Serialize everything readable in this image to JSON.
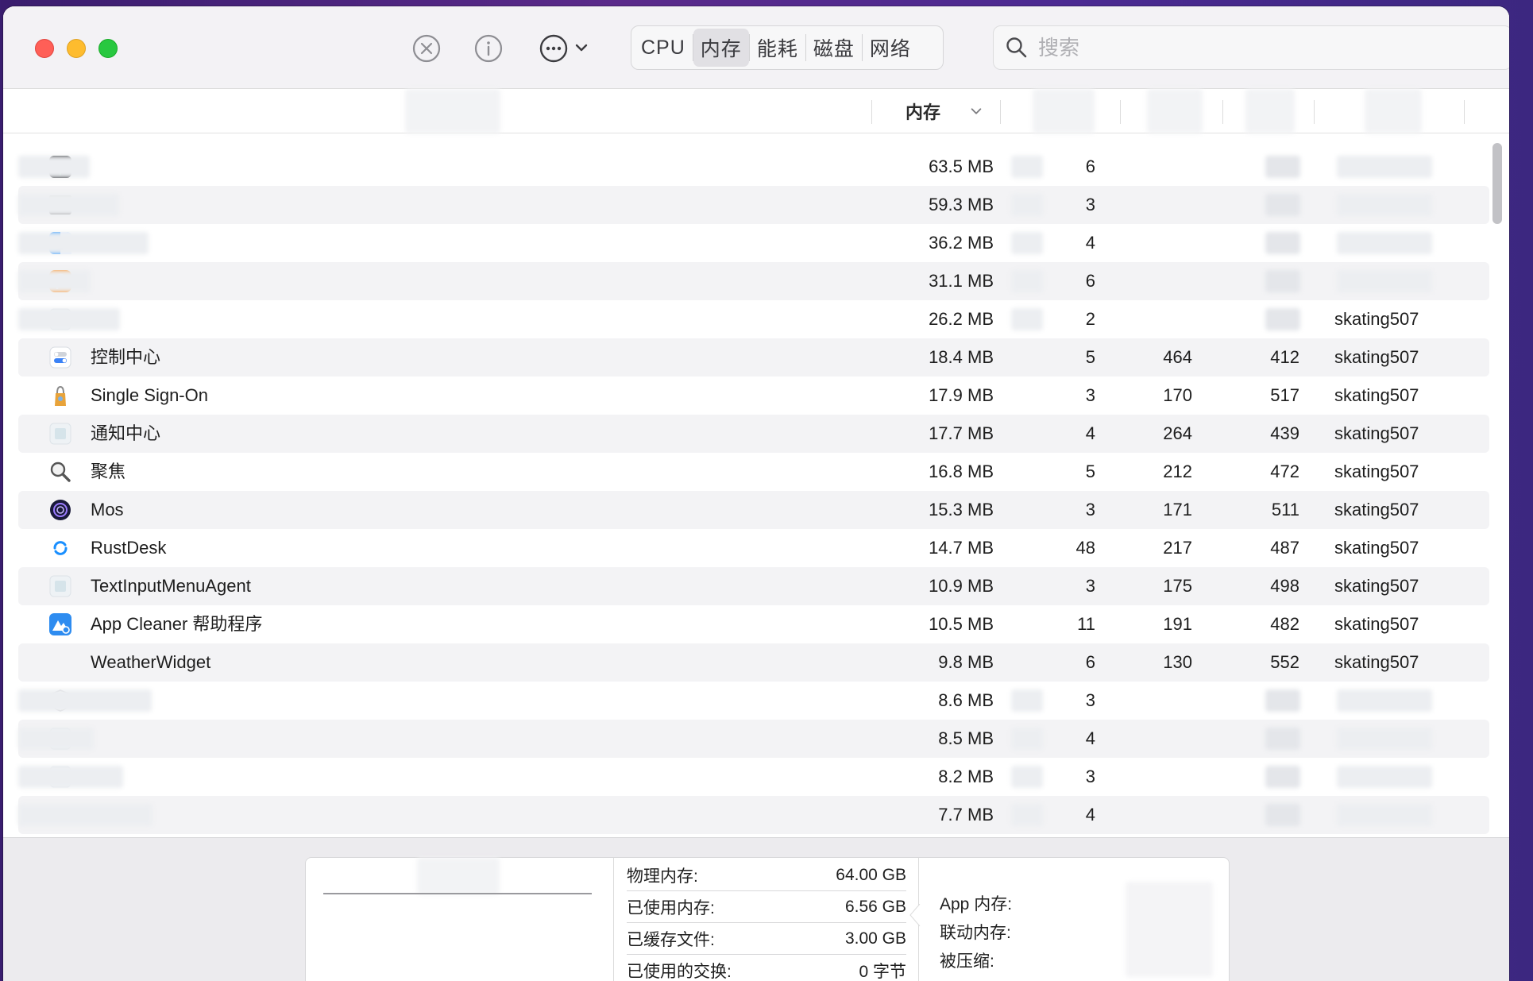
{
  "toolbar": {
    "tabs": [
      {
        "label": "CPU",
        "active": false
      },
      {
        "label": "内存",
        "active": true
      },
      {
        "label": "能耗",
        "active": false
      },
      {
        "label": "磁盘",
        "active": false
      },
      {
        "label": "网络",
        "active": false
      }
    ],
    "search_placeholder": "搜索"
  },
  "header": {
    "memory_col": "内存"
  },
  "rows": [
    {
      "name": "",
      "mem": "63.5 MB",
      "threads": "6",
      "ports": "",
      "pid": "",
      "user": "",
      "icon": "activity-monitor-icon"
    },
    {
      "name": "",
      "mem": "59.3 MB",
      "threads": "3",
      "ports": "",
      "pid": "",
      "user": "",
      "icon": "terminal-icon"
    },
    {
      "name": "",
      "mem": "36.2 MB",
      "threads": "4",
      "ports": "",
      "pid": "",
      "user": "",
      "icon": "finder-icon"
    },
    {
      "name": "",
      "mem": "31.1 MB",
      "threads": "6",
      "ports": "",
      "pid": "",
      "user": "",
      "icon": "app-orange-icon"
    },
    {
      "name": "",
      "mem": "26.2 MB",
      "threads": "2",
      "ports": "",
      "pid": "",
      "user": "skating507",
      "icon": "generic-app-icon"
    },
    {
      "name": "控制中心",
      "mem": "18.4 MB",
      "threads": "5",
      "ports": "464",
      "pid": "412",
      "user": "skating507",
      "icon": "control-center-icon"
    },
    {
      "name": "Single Sign-On",
      "mem": "17.9 MB",
      "threads": "3",
      "ports": "170",
      "pid": "517",
      "user": "skating507",
      "icon": "single-sign-on-icon"
    },
    {
      "name": "通知中心",
      "mem": "17.7 MB",
      "threads": "4",
      "ports": "264",
      "pid": "439",
      "user": "skating507",
      "icon": "generic-app-icon"
    },
    {
      "name": "聚焦",
      "mem": "16.8 MB",
      "threads": "5",
      "ports": "212",
      "pid": "472",
      "user": "skating507",
      "icon": "spotlight-icon"
    },
    {
      "name": "Mos",
      "mem": "15.3 MB",
      "threads": "3",
      "ports": "171",
      "pid": "511",
      "user": "skating507",
      "icon": "mos-icon"
    },
    {
      "name": "RustDesk",
      "mem": "14.7 MB",
      "threads": "48",
      "ports": "217",
      "pid": "487",
      "user": "skating507",
      "icon": "rustdesk-icon"
    },
    {
      "name": "TextInputMenuAgent",
      "mem": "10.9 MB",
      "threads": "3",
      "ports": "175",
      "pid": "498",
      "user": "skating507",
      "icon": "generic-app-icon"
    },
    {
      "name": "App Cleaner 帮助程序",
      "mem": "10.5 MB",
      "threads": "11",
      "ports": "191",
      "pid": "482",
      "user": "skating507",
      "icon": "app-cleaner-icon"
    },
    {
      "name": "WeatherWidget",
      "mem": "9.8 MB",
      "threads": "6",
      "ports": "130",
      "pid": "552",
      "user": "skating507",
      "icon": "none"
    },
    {
      "name": "",
      "mem": "8.6 MB",
      "threads": "3",
      "ports": "",
      "pid": "",
      "user": "",
      "icon": "shield-icon"
    },
    {
      "name": "",
      "mem": "8.5 MB",
      "threads": "4",
      "ports": "",
      "pid": "",
      "user": "",
      "icon": "generic-app-icon"
    },
    {
      "name": "",
      "mem": "8.2 MB",
      "threads": "3",
      "ports": "",
      "pid": "",
      "user": "",
      "icon": "generic-app-icon"
    },
    {
      "name": "",
      "mem": "7.7 MB",
      "threads": "4",
      "ports": "",
      "pid": "",
      "user": "",
      "icon": "none"
    }
  ],
  "memory_stats": {
    "physical_label": "物理内存:",
    "physical_value": "64.00 GB",
    "used_label": "已使用内存:",
    "used_value": "6.56 GB",
    "cached_label": "已缓存文件:",
    "cached_value": "3.00 GB",
    "swap_label": "已使用的交换:",
    "swap_value": "0 字节",
    "app_label": "App 内存:",
    "wired_label": "联动内存:",
    "compressed_label": "被压缩:"
  }
}
